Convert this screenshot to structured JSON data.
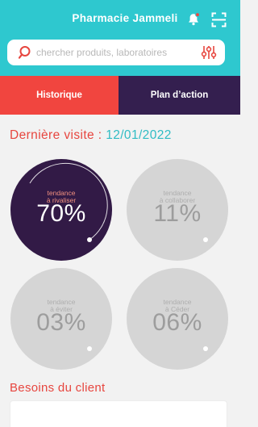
{
  "header": {
    "title": "Pharmacie Jammeli",
    "icons": [
      "bell-icon",
      "scan-icon"
    ]
  },
  "search": {
    "placeholder": "chercher produits, laboratoires",
    "value": ""
  },
  "tabs": [
    {
      "label": "Historique",
      "active": true
    },
    {
      "label": "Plan d’action",
      "active": false
    }
  ],
  "last_visit": {
    "label": "Dernière visite : ",
    "date": "12/01/2022"
  },
  "tendencies": [
    {
      "label_line1": "tendance",
      "label_line2": "à rivaliser",
      "value": "70%",
      "selected": true
    },
    {
      "label_line1": "tendance",
      "label_line2": "à collaborer",
      "value": "11%",
      "selected": false
    },
    {
      "label_line1": "tendance",
      "label_line2": "à éviter",
      "value": "03%",
      "selected": false
    },
    {
      "label_line1": "tendance",
      "label_line2": "à Céder",
      "value": "06%",
      "selected": false
    }
  ],
  "needs": {
    "title": "Besoins du client"
  },
  "colors": {
    "header": "#2ec8cf",
    "tab_active": "#f1453f",
    "tab_inactive": "#341f4f",
    "accent_red": "#e7463f",
    "accent_teal": "#2fbcc4",
    "circle_selected": "#321a46",
    "circle_default": "#d5d5d5"
  }
}
